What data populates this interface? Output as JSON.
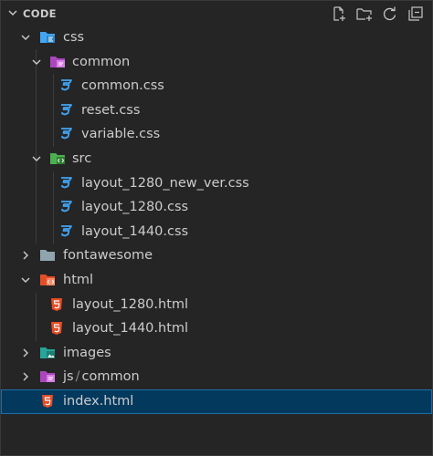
{
  "explorer": {
    "section_title": "CODE",
    "actions": [
      {
        "name": "new-file-icon"
      },
      {
        "name": "new-folder-icon"
      },
      {
        "name": "refresh-icon"
      },
      {
        "name": "collapse-all-icon"
      }
    ]
  },
  "tree": {
    "css": "css",
    "common": "common",
    "common_css": "common.css",
    "reset_css": "reset.css",
    "variable_css": "variable.css",
    "src": "src",
    "layout_1280_new_ver_css": "layout_1280_new_ver.css",
    "layout_1280_css": "layout_1280.css",
    "layout_1440_css": "layout_1440.css",
    "fontawesome": "fontawesome",
    "html": "html",
    "layout_1280_html": "layout_1280.html",
    "layout_1440_html": "layout_1440.html",
    "images": "images",
    "js": "js",
    "js_sep": "/",
    "js_common": "common",
    "index_html": "index.html"
  },
  "colors": {
    "css_blue": "#42a5f5",
    "html_red": "#e44d26",
    "selected_bg": "#04395e"
  }
}
